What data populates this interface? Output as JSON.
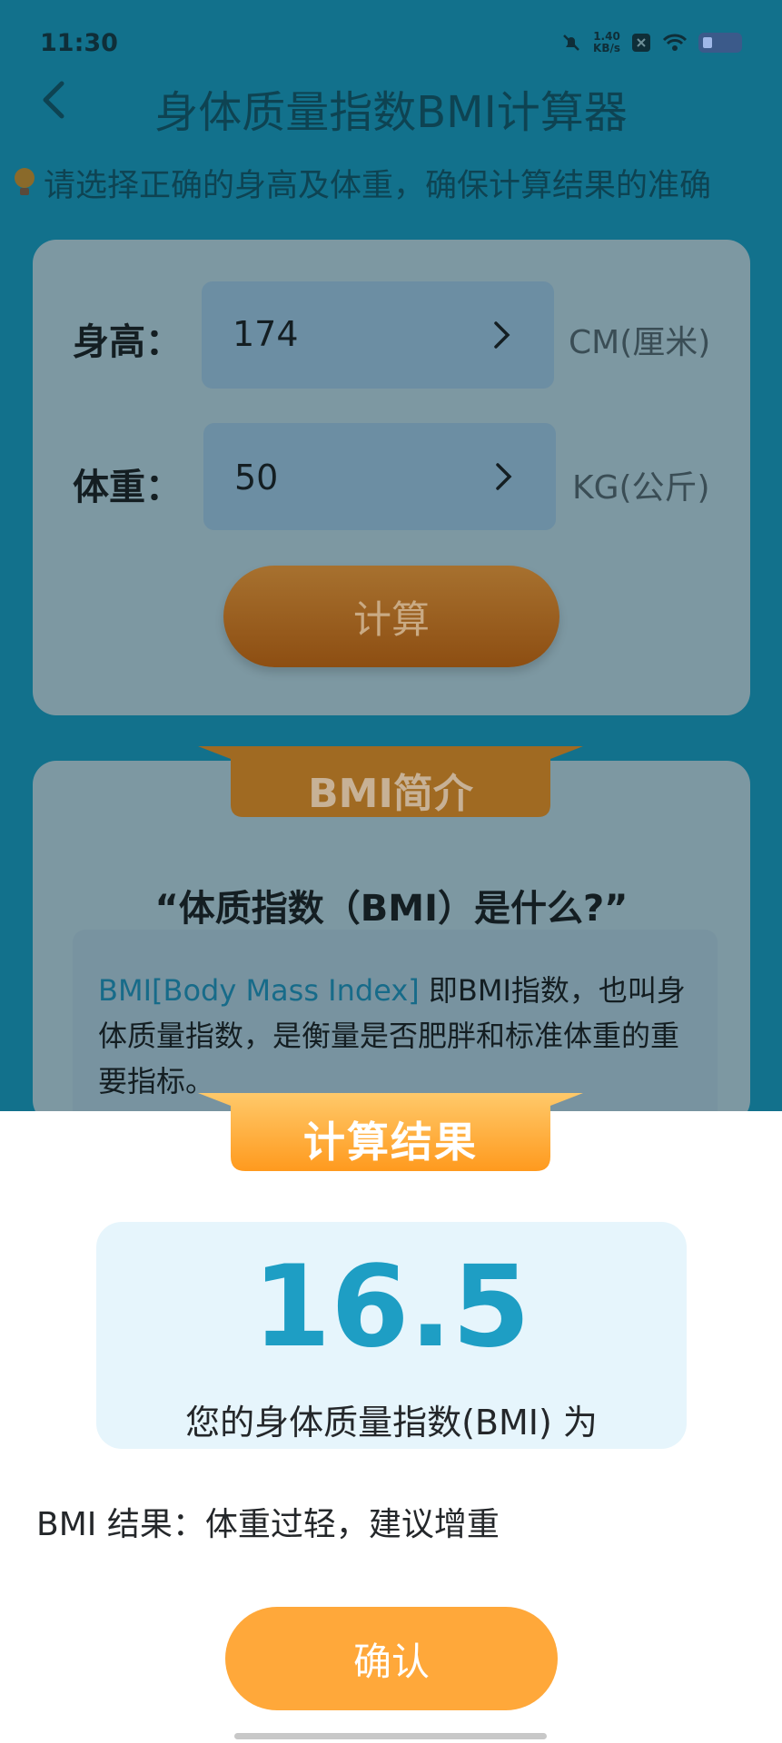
{
  "status_bar": {
    "time": "11:30",
    "net_speed_value": "1.40",
    "net_speed_unit": "KB/s"
  },
  "header": {
    "title": "身体质量指数BMI计算器"
  },
  "tip": "请选择正确的身高及体重，确保计算结果的准确",
  "form": {
    "height_label": "身高：",
    "height_value": "174",
    "height_unit": "CM(厘米)",
    "weight_label": "体重：",
    "weight_value": "50",
    "weight_unit": "KG(公斤)",
    "calc_button": "计算"
  },
  "intro": {
    "ribbon": "BMI简介",
    "question": "“体质指数（BMI）是什么?”",
    "highlight": "BMI[Body Mass Index]",
    "text": " 即BMI指数，也叫身体质量指数，是衡量是否肥胖和标准体重的重要指标。"
  },
  "result": {
    "title": "计算结果",
    "bmi": "16.5",
    "caption": "您的身体质量指数(BMI) 为",
    "summary": "BMI 结果：体重过轻，建议增重",
    "confirm": "确认"
  },
  "colors": {
    "accent_orange": "#ffa83a",
    "bmi_blue": "#1e9ec4",
    "header_teal": "#12718c"
  }
}
